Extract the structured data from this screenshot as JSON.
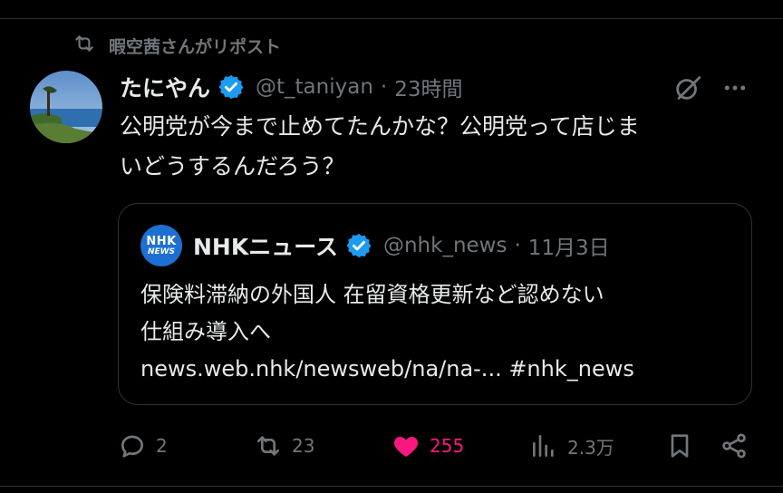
{
  "repost_banner": {
    "text": "暇空茜さんがリポスト",
    "icon": "repost-icon"
  },
  "post": {
    "author": {
      "display_name": "たにやん",
      "handle": "@t_taniyan",
      "verified": true,
      "avatar": "coastal-landscape-avatar"
    },
    "separator": "·",
    "time": "23時間",
    "text_line1": "公明党が今まで止めてたんかな？公明党って店じま",
    "text_line2": "いどうするんだろう？",
    "quote": {
      "author": {
        "display_name": "NHKニュース",
        "handle": "@nhk_news",
        "verified": true,
        "logo_line1": "NHK",
        "logo_line2": "NEWS"
      },
      "time": "11月3日",
      "text_line1": "保険料滞納の外国人 在留資格更新など認めない",
      "text_line2": "仕組み導入へ",
      "text_line3": "news.web.nhk/newsweb/na/na-... #nhk_news"
    }
  },
  "actions": {
    "reply_count": "2",
    "repost_count": "23",
    "like_count": "255",
    "view_count": "2.3万"
  },
  "colors": {
    "background": "#000000",
    "text": "#e7e9ea",
    "muted": "#71767b",
    "like": "#f91880",
    "verified": "#1d9bf0",
    "nhk_blue": "#1d6fd1"
  }
}
